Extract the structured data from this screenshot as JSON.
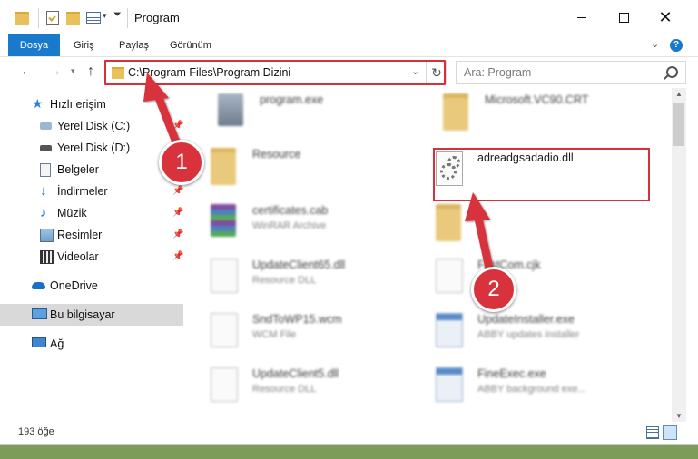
{
  "window": {
    "title": "Program",
    "controls": {
      "minimize": "minimize",
      "maximize": "maximize",
      "close": "✕"
    }
  },
  "ribbon": {
    "tabs": [
      "Dosya",
      "Giriş",
      "Paylaş",
      "Görünüm"
    ],
    "help": "?"
  },
  "nav": {
    "address": "C:\\Program Files\\Program Dizini",
    "search_placeholder": "Ara: Program"
  },
  "sidebar": {
    "items": [
      {
        "label": "Hızlı erişim",
        "icon": "star-icon"
      },
      {
        "label": "Yerel Disk (C:)",
        "icon": "drive-icon",
        "pinned": true
      },
      {
        "label": "Yerel Disk (D:)",
        "icon": "drive-icon"
      },
      {
        "label": "Belgeler",
        "icon": "documents-icon",
        "pinned": true
      },
      {
        "label": "İndirmeler",
        "icon": "download-icon",
        "pinned": true
      },
      {
        "label": "Müzik",
        "icon": "music-icon",
        "pinned": true
      },
      {
        "label": "Resimler",
        "icon": "pictures-icon",
        "pinned": true
      },
      {
        "label": "Videolar",
        "icon": "videos-icon",
        "pinned": true
      },
      {
        "label": "OneDrive",
        "icon": "cloud-icon"
      },
      {
        "label": "Bu bilgisayar",
        "icon": "computer-icon",
        "selected": true
      },
      {
        "label": "Ağ",
        "icon": "network-icon"
      }
    ]
  },
  "files": [
    {
      "name": "program.exe",
      "type": "",
      "icon": "exe-icon"
    },
    {
      "name": "Microsoft.VC90.CRT",
      "type": "",
      "icon": "folder-icon"
    },
    {
      "name": "Resource",
      "type": "",
      "icon": "folder-icon"
    },
    {
      "name": "adreadgsadadio.dll",
      "type": "",
      "icon": "dll-icon"
    },
    {
      "name": "certificates.cab",
      "type": "WinRAR Archive",
      "icon": "archive-icon"
    },
    {
      "name": "",
      "type": "",
      "icon": "folder-icon"
    },
    {
      "name": "UpdateClient65.dll",
      "type": "Resource DLL",
      "icon": "document-icon"
    },
    {
      "name": "FirstCom.cjk",
      "type": "",
      "icon": "document-icon"
    },
    {
      "name": "SndToWP15.wcm",
      "type": "WCM File",
      "icon": "document-icon"
    },
    {
      "name": "UpdateInstaller.exe",
      "type": "ABBY updates installer",
      "icon": "window-icon"
    },
    {
      "name": "UpdateClient5.dll",
      "type": "Resource DLL",
      "icon": "document-icon"
    },
    {
      "name": "FineExec.exe",
      "type": "ABBY background exe...",
      "icon": "window-icon"
    }
  ],
  "status": {
    "count": "193 öğe"
  },
  "callouts": [
    "1",
    "2"
  ],
  "colors": {
    "accent": "#1979ca",
    "highlight": "#d6303a"
  }
}
